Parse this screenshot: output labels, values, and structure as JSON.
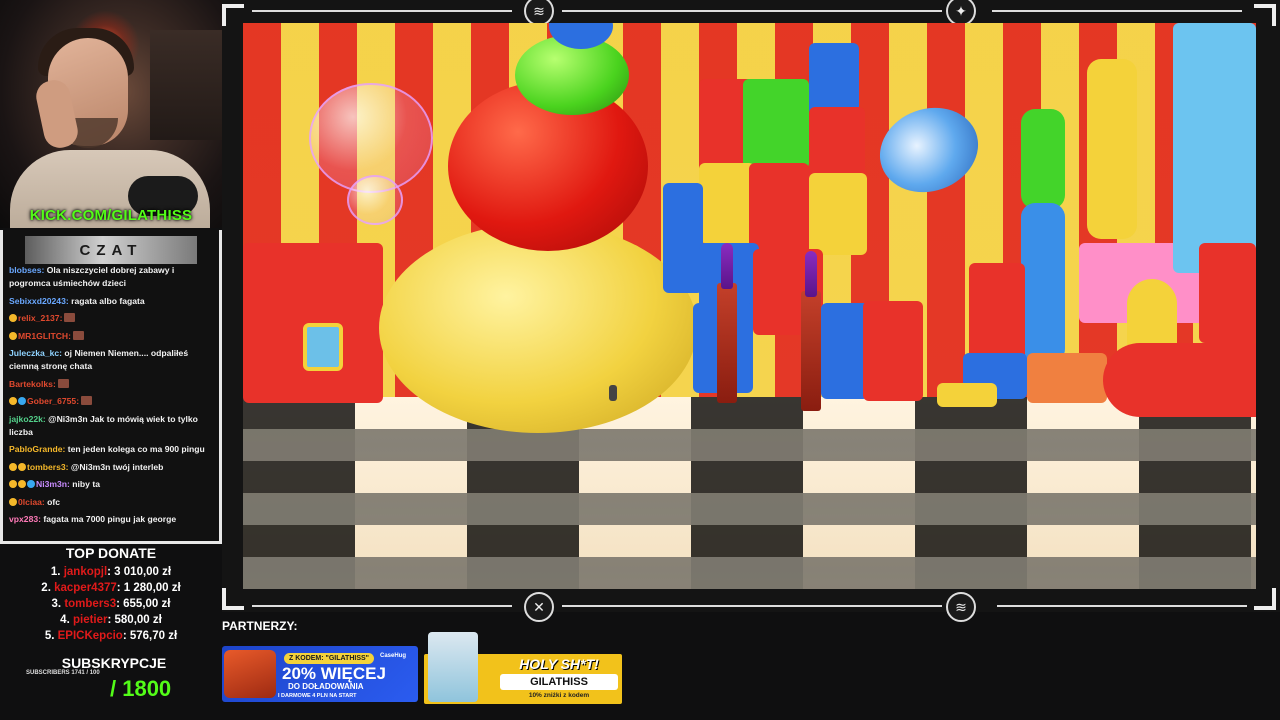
{
  "stream": {
    "kick_url": "KICK.COM/GILATHISS"
  },
  "chat": {
    "title": "CZAT",
    "messages": [
      {
        "user": "blobses",
        "user_color": "#6aa8ff",
        "text": "Ola niszczyciel dobrej zabawy i pogromca uśmiechów dzieci",
        "badges": []
      },
      {
        "user": "Sebixxd20243",
        "user_color": "#6aa8ff",
        "text": "ragata albo fagata",
        "badges": []
      },
      {
        "user": "relix_2137",
        "user_color": "#e0492e",
        "text": "",
        "badges": [
          "#f5b82a"
        ],
        "emote": true
      },
      {
        "user": "MR1GLITCH",
        "user_color": "#e0492e",
        "text": "",
        "badges": [
          "#f5b82a"
        ],
        "emote": true
      },
      {
        "user": "Juleczka_kc",
        "user_color": "#8fd3ff",
        "text": "oj Niemen Niemen.... odpaliłeś ciemną stronę chata",
        "badges": []
      },
      {
        "user": "Bartekolks",
        "user_color": "#e0492e",
        "text": "",
        "badges": [],
        "emote": true
      },
      {
        "user": "Gober_6755",
        "user_color": "#e0492e",
        "text": "",
        "badges": [
          "#f5b82a",
          "#38a8f0"
        ],
        "emote": true
      },
      {
        "user": "jajko22k",
        "user_color": "#53d08a",
        "text": "@Ni3m3n Jak to mówią wiek to tylko liczba",
        "badges": []
      },
      {
        "user": "PabloGrande",
        "user_color": "#f5b82a",
        "text": "ten jeden kolega co ma 900 pingu",
        "badges": []
      },
      {
        "user": "tombers3",
        "user_color": "#f5b82a",
        "text": "@Ni3m3n twój interleb",
        "badges": [
          "#f5b82a",
          "#f5b82a"
        ]
      },
      {
        "user": "Ni3m3n",
        "user_color": "#c98cff",
        "text": "niby ta",
        "badges": [
          "#f5b82a",
          "#f5b82a",
          "#38a8f0"
        ]
      },
      {
        "user": "0lciaa",
        "user_color": "#e0492e",
        "text": "ofc",
        "badges": [
          "#f5b82a"
        ]
      },
      {
        "user": "vpx283",
        "user_color": "#ff7ab8",
        "text": "fagata ma 7000 pingu jak george",
        "badges": []
      }
    ]
  },
  "donate": {
    "title": "TOP DONATE",
    "rows": [
      {
        "rank": "1.",
        "name": "jankopjl",
        "amount": "3 010,00 zł"
      },
      {
        "rank": "2.",
        "name": "kacper4377",
        "amount": "1 280,00 zł"
      },
      {
        "rank": "3.",
        "name": "tombers3",
        "amount": "655,00 zł"
      },
      {
        "rank": "4.",
        "name": "pietier",
        "amount": "580,00 zł"
      },
      {
        "rank": "5.",
        "name": "EPICKepcio",
        "amount": "576,70 zł"
      }
    ]
  },
  "subs": {
    "title": "SUBSKRYPCJE",
    "count_line": "SUBSCRIBERS 1741 / 100",
    "goal": "/ 1800"
  },
  "partners": {
    "label": "PARTNERZY:",
    "banner1": {
      "code": "Z KODEM: \"GILATHISS\"",
      "brand": "CaseHug",
      "big": "20% WIĘCEJ",
      "sub": "DO DOŁADOWANIA",
      "tiny": "I DARMOWE 4 PLN NA START"
    },
    "banner2": {
      "headline": "HOLY SH*T!",
      "code": "GILATHISS",
      "discount": "10% zniżki z kodem"
    }
  },
  "icons": {
    "frame_top_left": "brand-logo-icon",
    "frame_top_right": "crosshair-icon",
    "frame_bottom_left": "circle-pattern-icon",
    "frame_bottom_right": "brand-logo-icon"
  }
}
